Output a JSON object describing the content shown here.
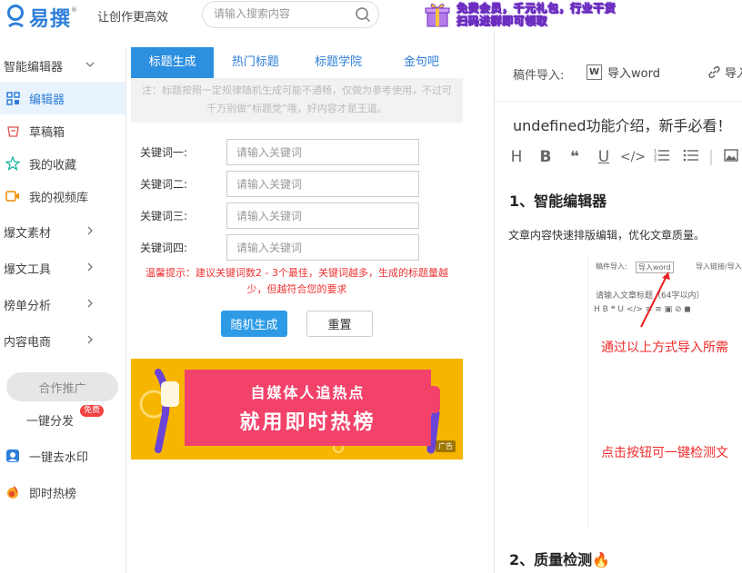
{
  "header": {
    "logo_text": "易撰",
    "logo_reg": "®",
    "slogan": "让创作更高效",
    "search_placeholder": "请输入搜索内容",
    "promo_line1": "免费会员，千元礼包，行业干货",
    "promo_line2": "扫码进群即可领取"
  },
  "sidebar": {
    "group_label": "智能编辑器",
    "items": [
      {
        "label": "编辑器",
        "icon": "grid-icon"
      },
      {
        "label": "草稿箱",
        "icon": "draft-box-icon"
      },
      {
        "label": "我的收藏",
        "icon": "star-icon"
      },
      {
        "label": "我的视频库",
        "icon": "video-icon"
      }
    ],
    "sections": [
      "爆文素材",
      "爆文工具",
      "榜单分析",
      "内容电商"
    ],
    "coop_label": "合作推广",
    "extras": [
      {
        "label": "一键分发",
        "badge": "免费"
      },
      {
        "label": "一键去水印",
        "icon": "watermark-icon"
      },
      {
        "label": "即时热榜",
        "icon": "fire-icon"
      }
    ]
  },
  "tool": {
    "tabs": [
      "标题生成",
      "热门标题",
      "标题学院",
      "金句吧"
    ],
    "notice": "注：标题按照一定规律随机生成可能不通畅，仅做为参考使用，不过可千万别做“标题党”哦，好内容才是王道。",
    "keywords": [
      {
        "label": "关键词一:",
        "placeholder": "请输入关键词"
      },
      {
        "label": "关键词二:",
        "placeholder": "请输入关键词"
      },
      {
        "label": "关键词三:",
        "placeholder": "请输入关键词"
      },
      {
        "label": "关键词四:",
        "placeholder": "请输入关键词"
      }
    ],
    "tip": "温馨提示：建议关键词数2 - 3个最佳，关键词越多，生成的标题量越少，但越符合您的要求",
    "generate_label": "随机生成",
    "reset_label": "重置",
    "banner_line1": "自媒体人追热点",
    "banner_line2": "就用即时热榜",
    "ad_tag": "广告"
  },
  "editor": {
    "import_label": "稿件导入:",
    "word_icon": "W",
    "word_label": "导入word",
    "link_label": "导入链接",
    "doc_title": "undefined功能介绍，新手必看！",
    "format_tools": [
      "H",
      "B",
      "❝",
      "U",
      "</>",
      "ordered-list-icon",
      "unordered-list-icon",
      "image-icon"
    ],
    "section1": "1、智能编辑器",
    "paragraph1": "文章内容快速排版编辑，优化文章质量。",
    "shot_import": "稿件导入:",
    "shot_word": "导入word",
    "shot_link": "导入链接/导入",
    "shot_title_ph": "请输入文章标题（64字以内）",
    "shot_fmt": "H B ❝ U </> ≡ ≡ ▣ ⊘ ◼",
    "shot_red1": "通过以上方式导入所需",
    "shot_red2": "点击按钮可一键检测文",
    "section2": "2、质量检测🔥"
  }
}
